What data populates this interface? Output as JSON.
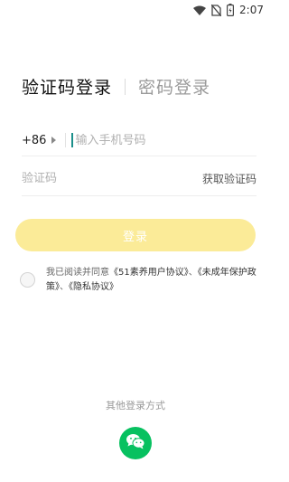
{
  "status_bar": {
    "time": "2:07",
    "icons": [
      "wifi-icon",
      "no-sim-icon",
      "battery-charging-icon"
    ]
  },
  "tabs": {
    "active": "验证码登录",
    "inactive": "密码登录"
  },
  "phone": {
    "country_code": "+86",
    "placeholder": "输入手机号码"
  },
  "code": {
    "placeholder": "验证码",
    "get_code_label": "获取验证码"
  },
  "login_button": {
    "label": "登录",
    "color": "#fbeb98"
  },
  "agreement": {
    "prefix": "我已阅读并同意",
    "user_agreement": "《51素养用户协议》",
    "sep1": "、",
    "minor_protection": "《未成年保护政策》",
    "sep2": "、",
    "privacy": "《隐私协议》"
  },
  "other_login": {
    "label": "其他登录方式",
    "wechat_color": "#07c160"
  }
}
